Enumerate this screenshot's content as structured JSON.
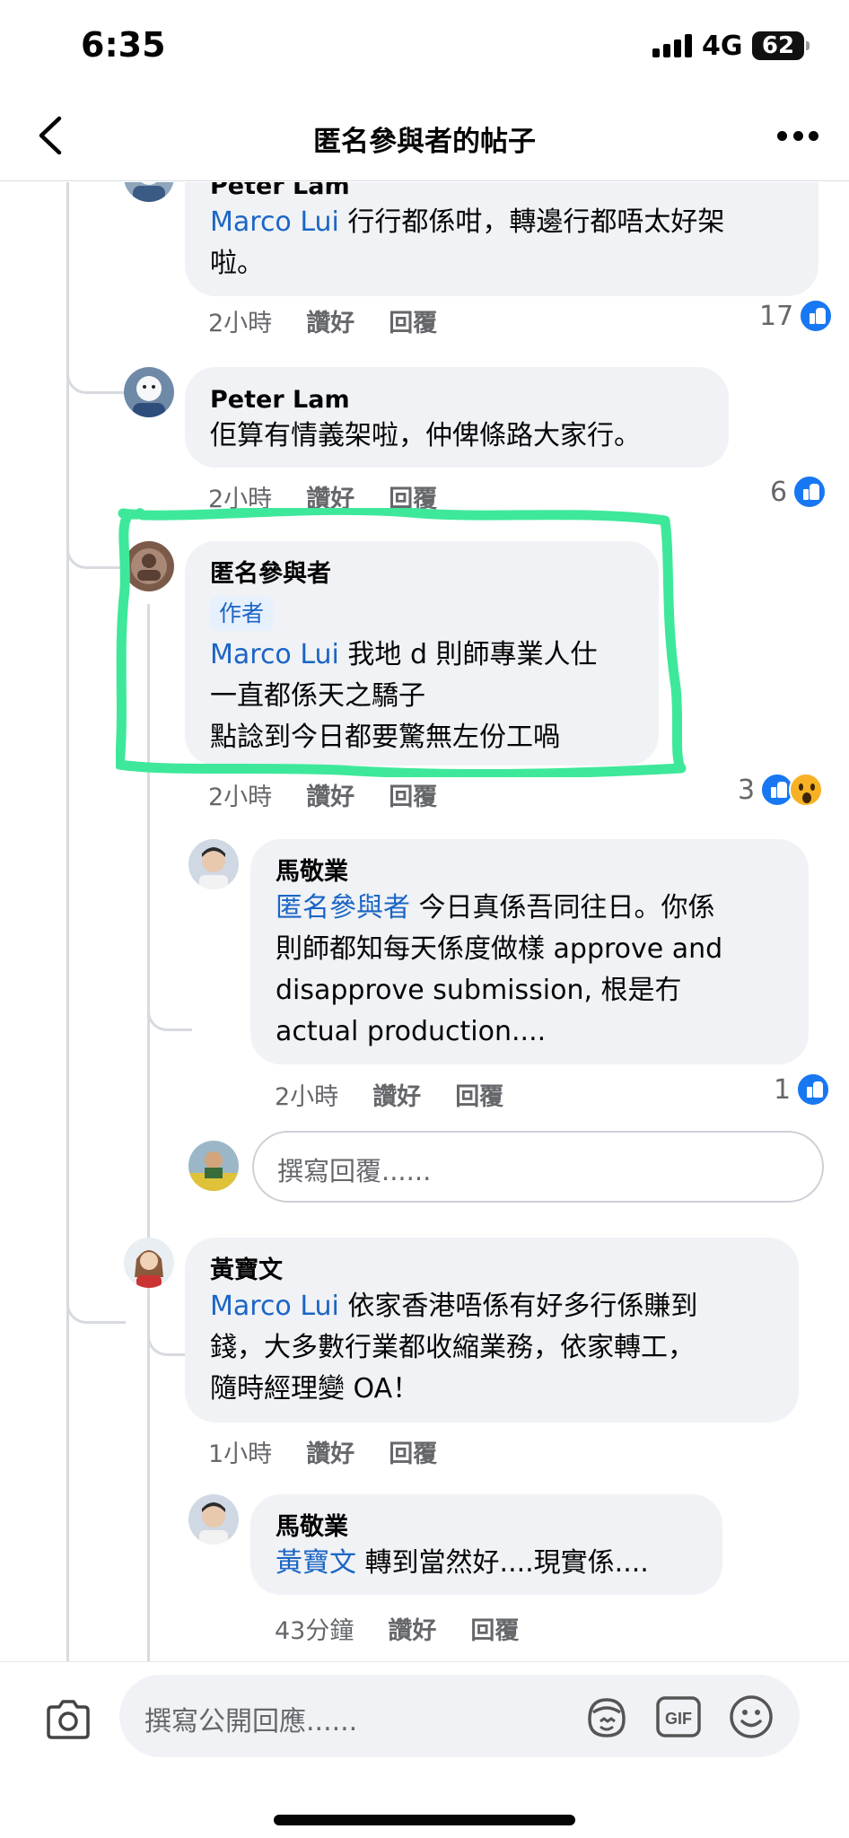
{
  "status_bar": {
    "time": "6:35",
    "network": "4G",
    "battery": "62"
  },
  "header": {
    "title": "匿名參與者的帖子"
  },
  "comments": [
    {
      "author": "Peter Lam",
      "mention": "Marco Lui",
      "text": " 行行都係咁，轉邊行都唔太好架\n啦。",
      "time": "2小時",
      "like_label": "讚好",
      "reply_label": "回覆",
      "reaction_count": "17"
    },
    {
      "author": "Peter Lam",
      "text": "佢算有情義架啦，仲俾條路大家行。",
      "time": "2小時",
      "like_label": "讚好",
      "reply_label": "回覆",
      "reaction_count": "6"
    },
    {
      "author": "匿名參與者",
      "badge": "作者",
      "mention": "Marco Lui",
      "text": " 我地 d 則師專業人仕\n一直都係天之驕子\n點諗到今日都要驚無左份工喎",
      "time": "2小時",
      "like_label": "讚好",
      "reply_label": "回覆",
      "reaction_count": "3"
    },
    {
      "author": "馬敬業",
      "mention": "匿名參與者",
      "text": " 今日真係吾同往日。你係\n則師都知每天係度做樣 approve and\ndisapprove submission,  根是冇\n actual production....",
      "time": "2小時",
      "like_label": "讚好",
      "reply_label": "回覆",
      "reaction_count": "1"
    },
    {
      "author": "黃寶文",
      "mention": "Marco Lui",
      "text": " 依家香港唔係有好多行係賺到\n錢，大多數行業都收縮業務，依家轉工，\n隨時經理變 OA！",
      "time": "1小時",
      "like_label": "讚好",
      "reply_label": "回覆"
    },
    {
      "author": "馬敬業",
      "mention": "黃寶文",
      "text": " 轉到當然好....現實係....",
      "time": "43分鐘",
      "like_label": "讚好",
      "reply_label": "回覆"
    }
  ],
  "reply_box": {
    "placeholder": "撰寫回覆......"
  },
  "composer": {
    "placeholder": "撰寫公開回應......"
  },
  "colors": {
    "mention": "#1b65c5",
    "like": "#1877f2",
    "highlight": "#3ee89a"
  }
}
